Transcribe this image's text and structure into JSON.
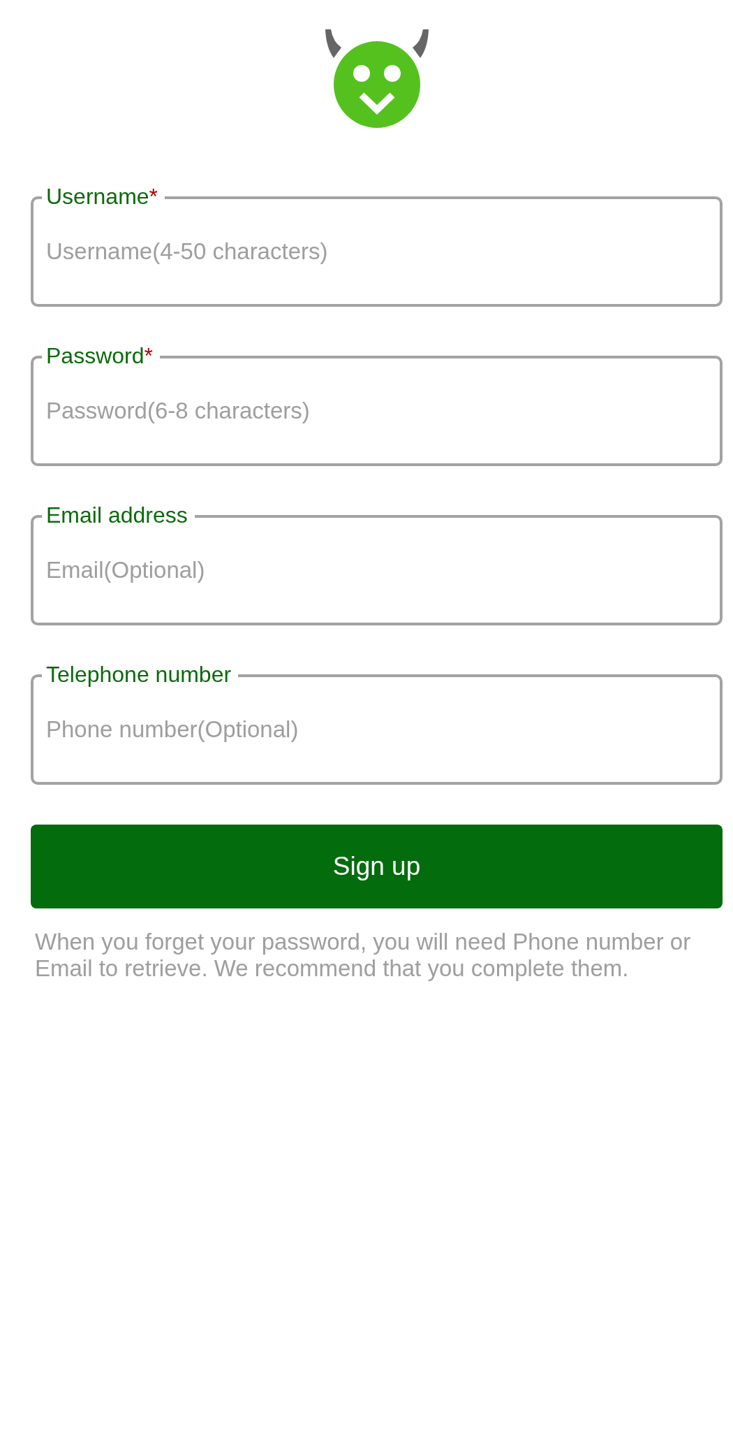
{
  "fields": [
    {
      "label": "Username",
      "required_mark": "*",
      "placeholder": "Username(4-50 characters)"
    },
    {
      "label": "Password",
      "required_mark": "*",
      "placeholder": "Password(6-8 characters)"
    },
    {
      "label": "Email address",
      "placeholder": "Email(Optional)"
    },
    {
      "label": "Telephone number",
      "placeholder": "Phone number(Optional)"
    }
  ],
  "submit_button": {
    "label": "Sign up"
  },
  "note": "When you forget your password, you will need Phone number or Email to retrieve. We recommend that you complete them."
}
